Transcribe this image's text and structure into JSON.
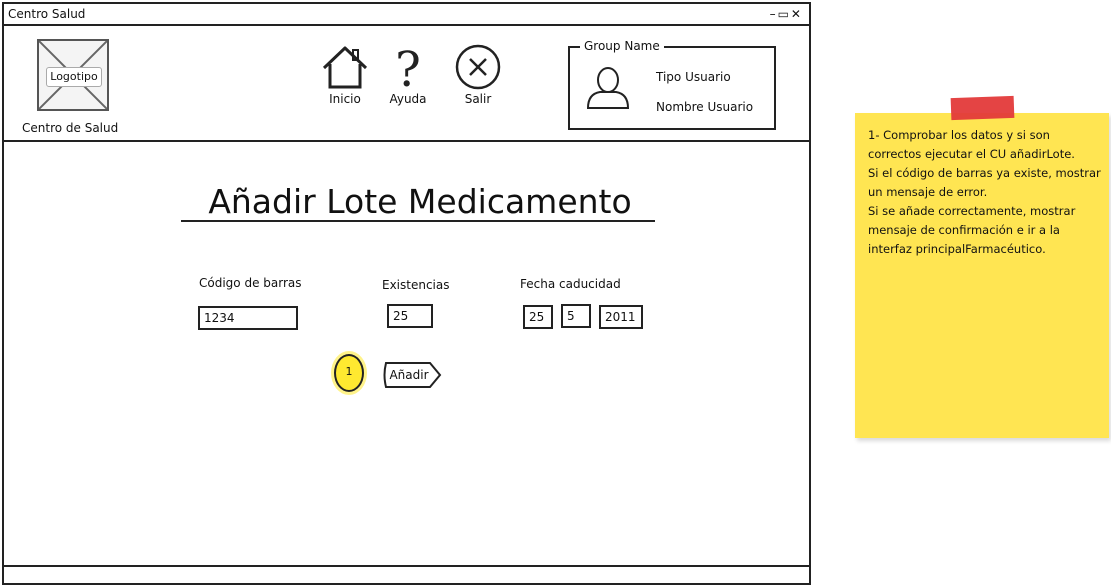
{
  "window": {
    "title": "Centro Salud",
    "controls": "–▭✕"
  },
  "header": {
    "logo": {
      "label": "Logotipo",
      "caption": "Centro  de Salud"
    },
    "nav": [
      {
        "id": "inicio",
        "label": "Inicio",
        "icon": "home-icon"
      },
      {
        "id": "ayuda",
        "label": "Ayuda",
        "icon": "help-icon"
      },
      {
        "id": "salir",
        "label": "Salir",
        "icon": "close-circle-icon"
      }
    ],
    "group": {
      "legend": "Group Name",
      "user_type": "Tipo Usuario",
      "user_name": "Nombre Usuario",
      "icon": "user-icon"
    }
  },
  "main": {
    "title": "Añadir Lote Medicamento",
    "fields": {
      "barcode": {
        "label": "Código de barras",
        "value": "1234"
      },
      "stock": {
        "label": "Existencias",
        "value": "25"
      },
      "expiry": {
        "label": "Fecha caducidad",
        "day": "25",
        "month": "5",
        "year": "2011"
      }
    },
    "step_badge": "1",
    "add_button": "Añadir"
  },
  "note": {
    "text": "1- Comprobar los datos y si son correctos ejecutar el CU añadirLote.\nSi el código de barras ya existe, mostrar un mensaje de error.\nSi se añade correctamente, mostrar mensaje de confirmación e ir a la interfaz principalFarmacéutico.",
    "color": "#ffe552",
    "tape_color": "#e33a3a"
  }
}
